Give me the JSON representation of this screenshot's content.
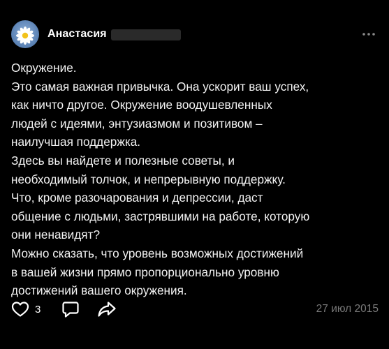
{
  "post": {
    "author": "Анастасия",
    "lines": [
      "Окружение.",
      "Это самая важная привычка. Она ускорит ваш успех,",
      "как ничто другое. Окружение воодушевленных",
      "людей с идеями, энтузиазмом и позитивом –",
      "наилучшая поддержка.",
      "Здесь вы найдете и полезные советы, и",
      "необходимый толчок, и непрерывную поддержку.",
      "Что, кроме разочарования и депрессии, даст",
      "общение с людьми, застрявшими на работе, которую",
      "они ненавидят?",
      "Можно сказать, что уровень возможных достижений",
      "в вашей жизни прямо пропорционально уровню",
      "достижений вашего окружения."
    ],
    "likes": "3",
    "date": "27 июл 2015"
  },
  "icons": {
    "avatar": "daisy-avatar",
    "more": "more-dots-icon",
    "like": "heart-icon",
    "comment": "comment-bubble-icon",
    "share": "share-arrow-icon"
  },
  "colors": {
    "background": "#000000",
    "text": "#f2f2f2",
    "muted": "#7a7a7a"
  }
}
